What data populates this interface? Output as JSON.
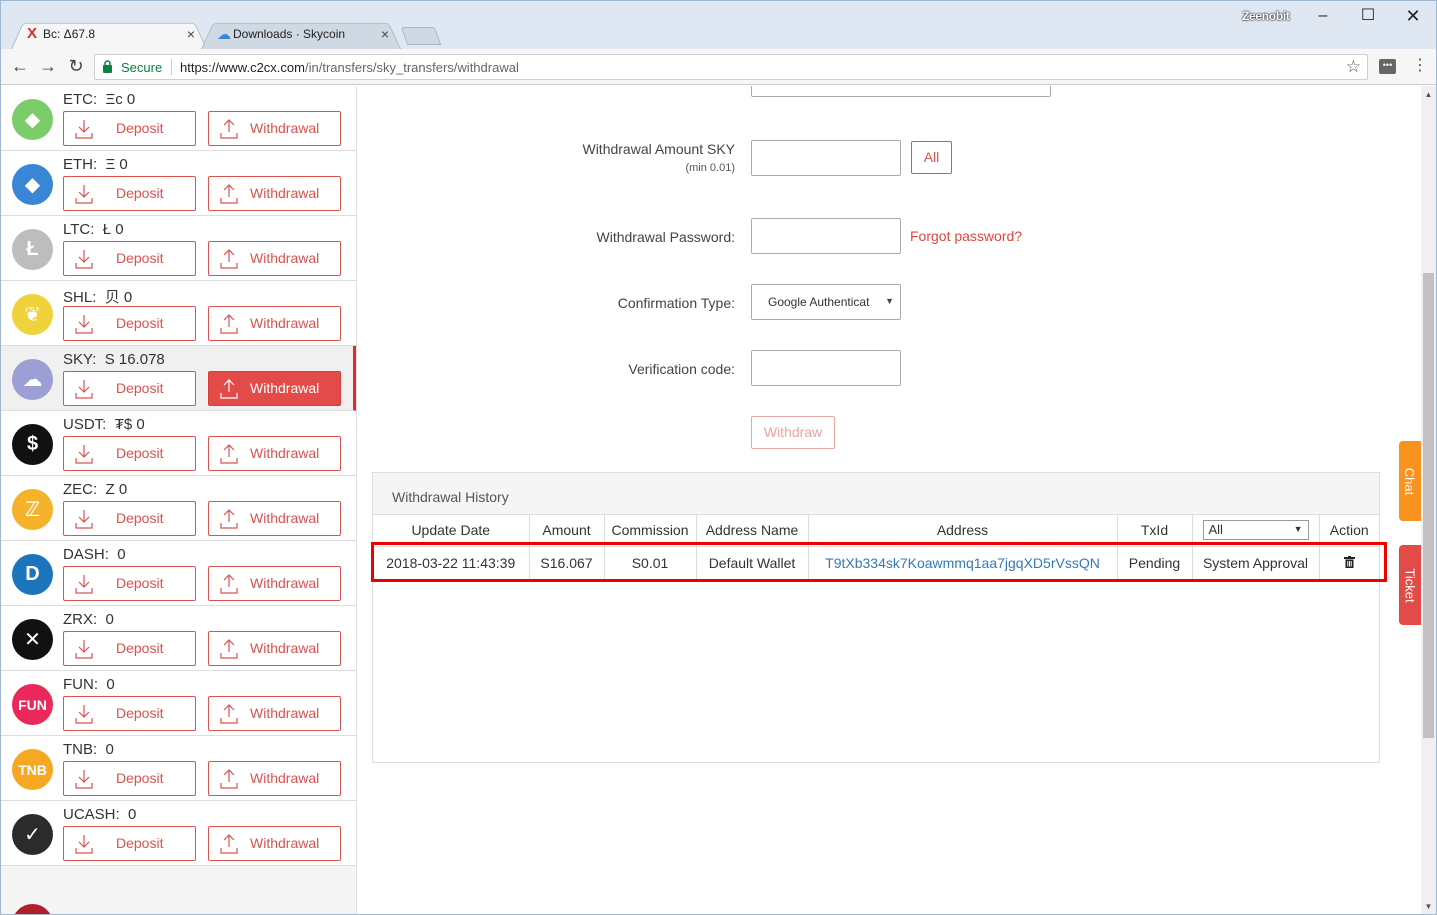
{
  "browser": {
    "tabs": [
      {
        "label": "Bc: Δ67.8",
        "icon": "x-brand-icon",
        "active": true
      },
      {
        "label": "Downloads · Skycoin",
        "icon": "cloud-icon",
        "active": false
      }
    ],
    "profile": "Zeenobit",
    "secure_label": "Secure",
    "url_host": "https://www.c2cx.com",
    "url_path": "/in/transfers/sky_transfers/withdrawal",
    "close_glyph": "×"
  },
  "sidebar": {
    "deposit_label": "Deposit",
    "withdrawal_label": "Withdrawal",
    "coins": [
      {
        "name": "ETC",
        "balance": "Ξc 0",
        "color": "#7ccd69",
        "glyph": "◆"
      },
      {
        "name": "ETH",
        "balance": "Ξ 0",
        "color": "#3a86d6",
        "glyph": "◆"
      },
      {
        "name": "LTC",
        "balance": "Ł 0",
        "color": "#bdbdbd",
        "glyph": "Ł"
      },
      {
        "name": "SHL",
        "balance": "贝 0",
        "color": "#f0d23c",
        "glyph": "❦"
      },
      {
        "name": "SKY",
        "balance": "S 16.078",
        "color": "#9b9fd3",
        "glyph": "☁",
        "selected": true
      },
      {
        "name": "USDT",
        "balance": "₮$ 0",
        "color": "#111111",
        "glyph": "$"
      },
      {
        "name": "ZEC",
        "balance": "Z 0",
        "color": "#f4b32a",
        "glyph": "ℤ"
      },
      {
        "name": "DASH",
        "balance": "0",
        "color": "#1c75bc",
        "glyph": "D"
      },
      {
        "name": "ZRX",
        "balance": "0",
        "color": "#111111",
        "glyph": "✕"
      },
      {
        "name": "FUN",
        "balance": "0",
        "color": "#ea2859",
        "glyph": "FUN"
      },
      {
        "name": "TNB",
        "balance": "0",
        "color": "#f7a823",
        "glyph": "TNB"
      },
      {
        "name": "UCASH",
        "balance": "0",
        "color": "#2b2b2b",
        "glyph": "✓"
      }
    ]
  },
  "form": {
    "amount_label": "Withdrawal Amount SKY",
    "amount_min": "(min 0.01)",
    "all_label": "All",
    "password_label": "Withdrawal Password:",
    "forgot_label": "Forgot password?",
    "confirmation_label": "Confirmation Type:",
    "confirmation_value": "Google Authenticat",
    "verification_label": "Verification code:",
    "withdraw_label": "Withdraw"
  },
  "history": {
    "title": "Withdrawal History",
    "columns": [
      "Update Date",
      "Amount",
      "Commission",
      "Address Name",
      "Address",
      "TxId",
      "All",
      "Action"
    ],
    "rows": [
      {
        "date": "2018-03-22 11:43:39",
        "amount": "S16.067",
        "commission": "S0.01",
        "address_name": "Default Wallet",
        "address": "T9tXb334sk7Koawmmq1aa7jgqXD5rVssQN",
        "txid": "Pending",
        "status": "System Approval",
        "action_icon": "trash-icon"
      }
    ]
  },
  "floating": {
    "chat": "Chat",
    "ticket": "Ticket",
    "chat_color": "#f7931e",
    "ticket_color": "#e24b47"
  }
}
